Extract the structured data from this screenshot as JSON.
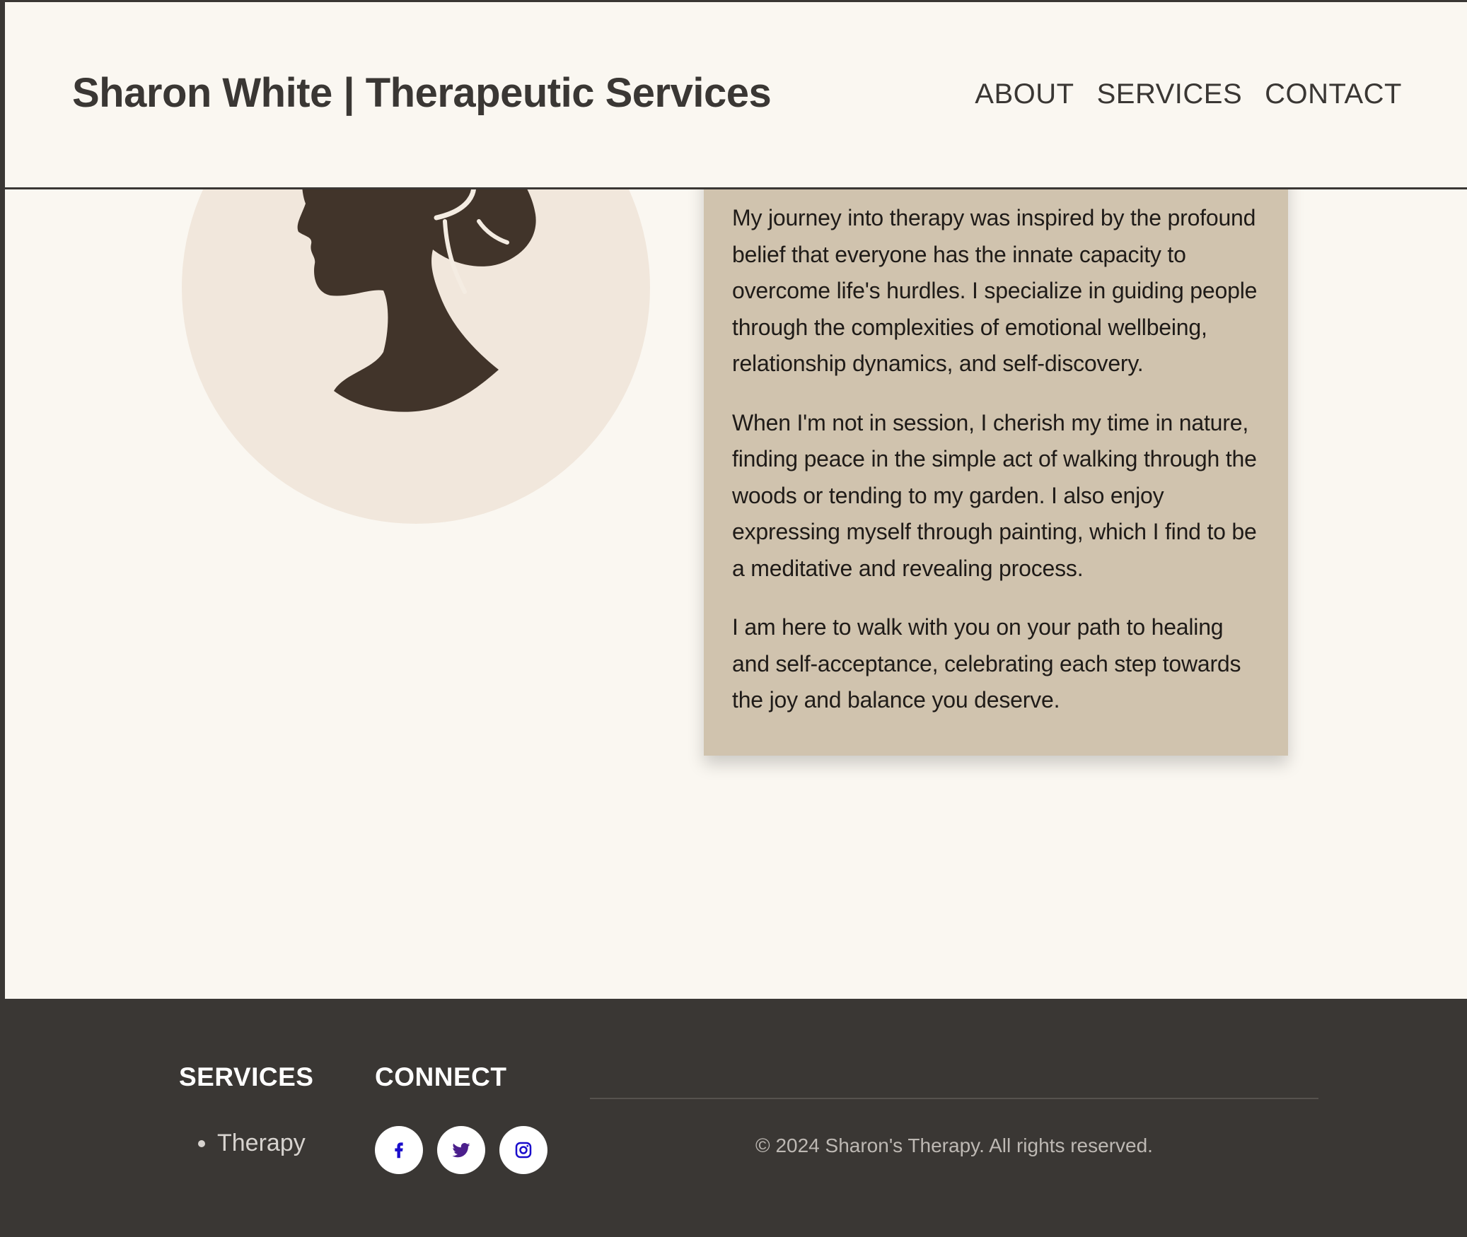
{
  "header": {
    "title": "Sharon White | Therapeutic Services",
    "nav": [
      "ABOUT",
      "SERVICES",
      "CONTACT"
    ]
  },
  "portrait": {
    "icon": "woman-silhouette-icon"
  },
  "bio": {
    "paragraphs": [
      "My journey into therapy was inspired by the profound belief that everyone has the innate capacity to overcome life's hurdles. I specialize in guiding people through the complexities of emotional wellbeing, relationship dynamics, and self-discovery.",
      "When I'm not in session, I cherish my time in nature, finding peace in the simple act of walking through the woods or tending to my garden. I also enjoy expressing myself through painting, which I find to be a meditative and revealing process.",
      "I am here to walk with you on your path to healing and self-acceptance, celebrating each step towards the joy and balance you deserve."
    ]
  },
  "footer": {
    "services_title": "SERVICES",
    "services_items": [
      "Therapy"
    ],
    "connect_title": "CONNECT",
    "social": [
      {
        "icon": "facebook-icon",
        "color": "#1a0dcc"
      },
      {
        "icon": "twitter-icon",
        "color": "#4b1f8c"
      },
      {
        "icon": "instagram-icon",
        "color": "#1a0dcc"
      }
    ],
    "copyright": "© 2024 Sharon's Therapy. All rights reserved."
  },
  "colors": {
    "background": "#faf7f1",
    "text_dark": "#3a3734",
    "card": "#d0c3ae",
    "portrait_bg": "#f1e7dc",
    "silhouette": "#41342a",
    "footer": "#3a3734"
  }
}
